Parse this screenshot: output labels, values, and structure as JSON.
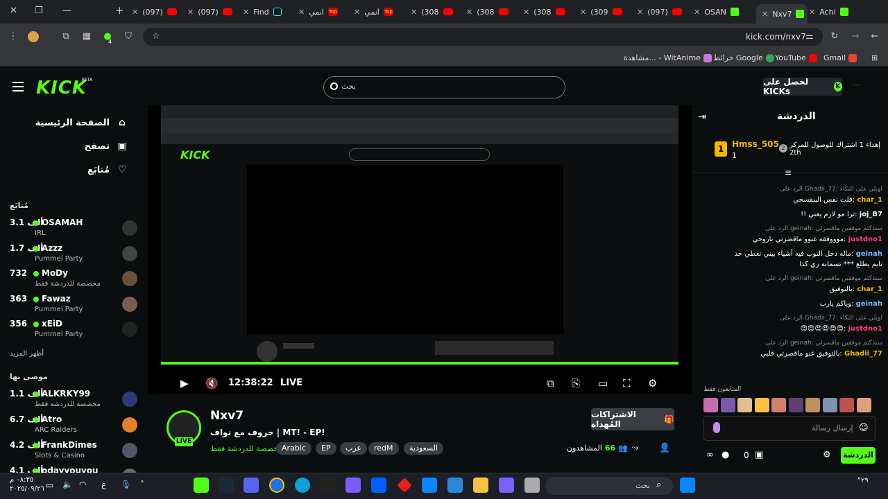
{
  "browser": {
    "tabs": [
      {
        "label": "(097)",
        "fav": "youtube"
      },
      {
        "label": "(097)",
        "fav": "youtube"
      },
      {
        "label": "Find",
        "fav": "tiktok"
      },
      {
        "label": "انمي",
        "fav": "top"
      },
      {
        "label": "انمي",
        "fav": "top"
      },
      {
        "label": "(308",
        "fav": "youtube"
      },
      {
        "label": "(308",
        "fav": "youtube"
      },
      {
        "label": "(308",
        "fav": "youtube"
      },
      {
        "label": "(309",
        "fav": "youtube"
      },
      {
        "label": "(097)",
        "fav": "youtube"
      },
      {
        "label": "OSAN",
        "fav": "kick"
      },
      {
        "label": "Nxv7",
        "fav": "kick",
        "active": true
      },
      {
        "label": "Achi",
        "fav": "kick"
      }
    ],
    "url": "kick.com/nxv7",
    "extension_badge": "4",
    "bookmarks": [
      "Gmail",
      "YouTube",
      "خرائط Google",
      "مشاهدة... - WitAnime"
    ]
  },
  "header": {
    "logo": "KICK",
    "beta": "BETA",
    "search_placeholder": "بحث",
    "kicks_button": "لحصل على KICKs"
  },
  "sidebar": {
    "nav": [
      {
        "label": "الصفحة الرئيسية",
        "icon": "home-icon"
      },
      {
        "label": "تصفح",
        "icon": "browse-icon"
      },
      {
        "label": "مُتابَع",
        "icon": "heart-icon"
      }
    ],
    "following_title": "مُتابَع",
    "following": [
      {
        "name": "OSAMAH",
        "category": "IRL",
        "viewers": "3.1 ألف"
      },
      {
        "name": "Azzz",
        "category": "Pummel Party",
        "viewers": "1.7 ألف"
      },
      {
        "name": "MoDy",
        "category": "مخصصة للدردشة فقط",
        "viewers": "732"
      },
      {
        "name": "Fawaz",
        "category": "Pummel Party",
        "viewers": "363"
      },
      {
        "name": "xEiD",
        "category": "Pummel Party",
        "viewers": "356"
      }
    ],
    "show_more": "أظهر المزيد",
    "recommended_title": "موصى بها",
    "recommended": [
      {
        "name": "ALKRKY99",
        "category": "مخصصة للدردشة فقط",
        "viewers": "1.1 ألف"
      },
      {
        "name": "Atro",
        "category": "ARC Raiders",
        "viewers": "6.7 ألف"
      },
      {
        "name": "FrankDimes",
        "category": "Slots & Casino",
        "viewers": "4.2 ألف"
      },
      {
        "name": "odayyouyou",
        "category": "",
        "viewers": "4.1 ألف"
      }
    ]
  },
  "player": {
    "time": "12:38:22",
    "live": "LIVE",
    "progress": 1.0
  },
  "stream": {
    "channel": "Nxv7",
    "live_badge": "LIVE",
    "title": "حروف مع نواف | MT! - EP!",
    "category": "مخصصة للدردشة فقط",
    "tags": [
      "السعودية",
      "redM",
      "عرب",
      "EP",
      "Arabic"
    ],
    "gift_button": "الاشتراكات المُهداة",
    "viewers_label": "المشاهدون",
    "viewers_count": "66"
  },
  "chat": {
    "title": "الدردشة",
    "pinned": {
      "user": "Hmss_505",
      "count": "1",
      "text": "إهداء 1 اشتراك للوصول للمركز",
      "rank_num": "2",
      "rank": "2th",
      "badge": "1"
    },
    "messages": [
      {
        "reply": "الرد على Ghadii_77: اوبلي على النكاء",
        "user": "char_1",
        "text": "قلت نفس البنفسجي",
        "color": "#f5b700"
      },
      {
        "reply": "",
        "user": "joj_B7",
        "text": "!! ترا مو لازم يعني",
        "color": "#fff"
      },
      {
        "reply": "الرد على geinah: ستذكتم موفقين ماقسرئي",
        "user": "justdno1",
        "text": "موووفقه غنوو ماقصرتي باروحي",
        "color": "#ff3b7a"
      },
      {
        "reply": "",
        "user": "geinah",
        "text": "ماله دخل التوب فيه أشياء بيني تعطي حد",
        "text2": "تابم يطلع *** تسمانه زي كذا",
        "color": "#7ab8ff"
      },
      {
        "reply": "الرد على geinah: ستذكتم موفقين ماقسرئي",
        "user": "char_1",
        "text": "بالتوفيق",
        "color": "#f5b700"
      },
      {
        "reply": "",
        "user": "geinah",
        "text": "وياكم يارب",
        "color": "#7ab8ff"
      },
      {
        "reply": "الرد على Ghadii_77: اوبلي على النكاء",
        "user": "justdno1",
        "text": "😍😍😍😍😍😍",
        "color": "#ff3b7a"
      },
      {
        "reply": "الرد على geinah: ستذكتم موفقين ماقسرئي",
        "user": "Ghadii_77",
        "text": "بالتوفيق غنو ماقصرتي قلبي",
        "color": "#f5b700"
      }
    ],
    "subscribers_only": "المتابعون فقط",
    "input_placeholder": "إرسال رسالة",
    "send_button": "الدردشة",
    "points": "0"
  },
  "taskbar": {
    "search_placeholder": "بحث",
    "time": "٠٨:٣٥ م",
    "date": "٢٠٢٥/٠٩/٢٦",
    "temp": "°٢٩",
    "lang": "ع"
  },
  "colors": {
    "kick_green": "#53fc18",
    "bg": "#0b0e0f"
  }
}
